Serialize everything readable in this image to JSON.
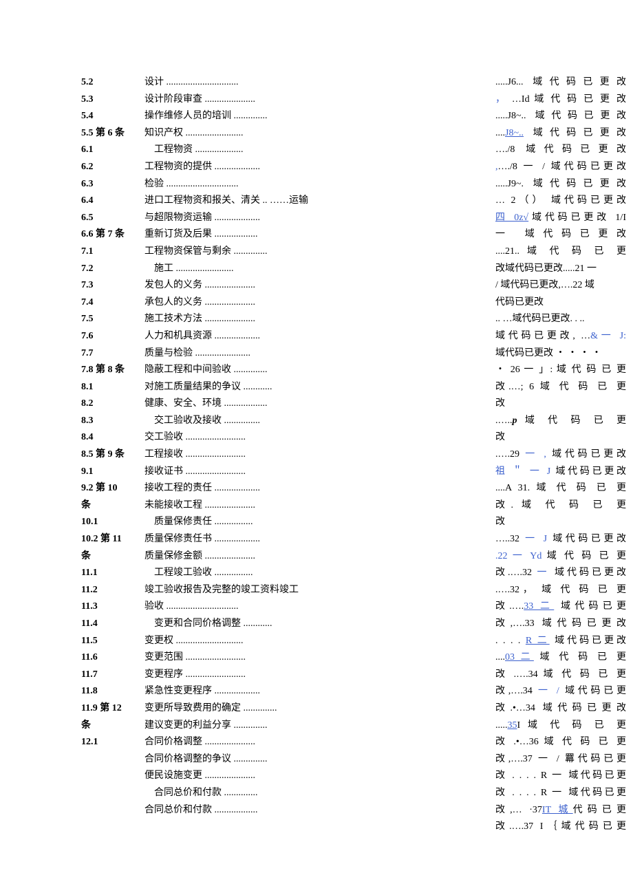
{
  "left_numbers": [
    {
      "t": "5.2"
    },
    {
      "t": "5.3"
    },
    {
      "t": "5.4"
    },
    {
      "t": "5.5 第 6 条"
    },
    {
      "t": "6.1"
    },
    {
      "t": "6.2"
    },
    {
      "t": "6.3"
    },
    {
      "t": "6.4"
    },
    {
      "t": "6.5"
    },
    {
      "t": "6.6 第 7 条"
    },
    {
      "t": "7.1"
    },
    {
      "t": "7.2"
    },
    {
      "t": "7.3"
    },
    {
      "t": "7.4"
    },
    {
      "t": "7.5"
    },
    {
      "t": "7.6"
    },
    {
      "t": "7.7"
    },
    {
      "t": "7.8 第 8 条"
    },
    {
      "t": "8.1"
    },
    {
      "t": "8.2"
    },
    {
      "t": "8.3"
    },
    {
      "t": "8.4"
    },
    {
      "t": "8.5 第 9 条"
    },
    {
      "t": "9.1"
    },
    {
      "t": "9.2 第 10"
    },
    {
      "t": "条"
    },
    {
      "t": "10.1"
    },
    {
      "t": "10.2 第 11"
    },
    {
      "t": "条"
    },
    {
      "t": "11.1"
    },
    {
      "t": "11.2"
    },
    {
      "t": "11.3"
    },
    {
      "t": "11.4"
    },
    {
      "t": "11.5"
    },
    {
      "t": "11.6"
    },
    {
      "t": "11.7"
    },
    {
      "t": "11.8"
    },
    {
      "t": "11.9 第 12"
    },
    {
      "t": "条"
    },
    {
      "t": "12.1"
    }
  ],
  "toc": [
    {
      "txt": "设计 ",
      "lead": ".............................."
    },
    {
      "txt": "设计阶段审查 ",
      "lead": "....................."
    },
    {
      "txt": "操作维修人员的培训 ",
      "lead": ".............."
    },
    {
      "txt": "知识产权 ",
      "lead": "........................"
    },
    {
      "txt": "工程物资 ",
      "lead": "....................",
      "indent": 1
    },
    {
      "txt": "工程物资的提供 ",
      "lead": "..................."
    },
    {
      "txt": "检验 ",
      "lead": ".............................."
    },
    {
      "txt": "进口工程物资和报关、清关 .. ……运输"
    },
    {
      "txt": "与超限物资运输 ",
      "lead": "..................."
    },
    {
      "txt": "重新订货及后果 ",
      "lead": ".................."
    },
    {
      "txt": "工程物资保管与剩余 ",
      "lead": ".............."
    },
    {
      "txt": "施工 ",
      "lead": "........................",
      "indent": 1
    },
    {
      "txt": "发包人的义务 ",
      "lead": "....................."
    },
    {
      "txt": "承包人的义务 ",
      "lead": "....................."
    },
    {
      "txt": "施工技术方法 ",
      "lead": "....................."
    },
    {
      "txt": "人力和机具资源 ",
      "lead": "..................."
    },
    {
      "txt": "质量与检验 ",
      "lead": "......................."
    },
    {
      "txt": "隐蔽工程和中间验收 ",
      "lead": ".............."
    },
    {
      "txt": "对施工质量结果的争议 ",
      "lead": "............"
    },
    {
      "txt": "健康、安全、环境 ",
      "lead": ".................."
    },
    {
      "txt": "交工验收及接收 ",
      "lead": "...............",
      "indent": 1
    },
    {
      "txt": "交工验收 ",
      "lead": "........................."
    },
    {
      "txt": "工程接收 ",
      "lead": "........................."
    },
    {
      "txt": "接收证书 ",
      "lead": "........................."
    },
    {
      "txt": "接收工程的责任 ",
      "lead": "..................."
    },
    {
      "txt": "未能接收工程 ",
      "lead": "....................."
    },
    {
      "txt": "质量保修责任 ",
      "lead": "................",
      "indent": 1
    },
    {
      "txt": "质量保修责任书 ",
      "lead": "..................."
    },
    {
      "txt": "质量保修金额 ",
      "lead": "....................."
    },
    {
      "txt": "工程竣工验收 ",
      "lead": "................",
      "indent": 1
    },
    {
      "txt": "竣工验收报告及完整的竣工资料竣工"
    },
    {
      "txt": "验收 ",
      "lead": ".............................."
    },
    {
      "txt": "变更和合同价格调整 ",
      "lead": "............",
      "indent": 1
    },
    {
      "txt": "变更权 ",
      "lead": "............................"
    },
    {
      "txt": "变更范围 ",
      "lead": "........................."
    },
    {
      "txt": "变更程序 ",
      "lead": "........................."
    },
    {
      "txt": "紧急性变更程序 ",
      "lead": "..................."
    },
    {
      "txt": "变更所导致费用的确定 ",
      "lead": ".............."
    },
    {
      "txt": "建议变更的利益分享 ",
      "lead": ".............."
    },
    {
      "txt": "合同价格调整 ",
      "lead": "....................."
    },
    {
      "txt": "合同价格调整的争议 ",
      "lead": ".............."
    },
    {
      "txt": "便民设施变更 ",
      "lead": "....................."
    },
    {
      "txt": "合同总价和付款 ",
      "lead": "..............",
      "indent": 1
    },
    {
      "txt": "合同总价和付款 ",
      "lead": ".................."
    }
  ],
  "right": [
    {
      "h": ".....J6...   域代码已更改"
    },
    {
      "h": "， …Id 域 代 码 已 更 改",
      "blue_pre": "，"
    },
    {
      "h": ".....J8~..    域代码已更改"
    },
    {
      "h": "....J8~..   域代码已更改",
      "under": "J8~.."
    },
    {
      "h": "…./8         域代码已更改"
    },
    {
      "h": ",…./8 一 / 域代码已更改",
      "blue_pre": ","
    },
    {
      "h": ".....J9~.    域代码已更改"
    },
    {
      "h": "… 2（）   域代码已更改"
    },
    {
      "h": "四 0z√域代码已更改 1/I",
      "under": "四 0z√"
    },
    {
      "h": "一              域代码已更改"
    },
    {
      "h": "....21..       域 代 码 已 更"
    },
    {
      "h": "改域代码已更改.....21 一",
      "noj": true
    },
    {
      "h": "/ 域代码已更改,….22 域",
      "noj": true
    },
    {
      "h": "代码已更改",
      "noj": true
    },
    {
      "h": ".. …域代码已更改. . ..",
      "noj": true
    },
    {
      "h": "域代码已更改, …&一 J:",
      "blue_post": "&一 J:"
    },
    {
      "h": "域代码已更改 ・ ・ ・ ・",
      "noj": true
    },
    {
      "h": "・ 26 一 」: 域 代 码 已 更"
    },
    {
      "h": "改.…;  6   域 代 码 已 更"
    },
    {
      "h": "改",
      "noj": true
    },
    {
      "h": ".…..p         域 代 码 已 更",
      "bold_p": true
    },
    {
      "h": "改",
      "noj": true
    },
    {
      "h": ".….29 一 , 域代码已更改",
      "blue_part": "一 ,"
    },
    {
      "h": "祖 ＂ 一 J 域代码已更改",
      "blue_pre": "祖 ＂ 一 J"
    },
    {
      "h": "....A 31.       域 代 码 已 更"
    },
    {
      "h": "改.            域 代 码 已 更"
    },
    {
      "h": "改",
      "noj": true
    },
    {
      "h": "…..32 一 J 域代码已更改",
      "blue_part": "一 J"
    },
    {
      "h": " .22 一 Yd 域 代 码 已 更",
      "blue_pre": ".22 一 Yd"
    },
    {
      "h": "改.….32 一 域代码已更改",
      "blue_part": "一"
    },
    {
      "h": ".….32，  域 代 码 已 更"
    },
    {
      "h": "改.….33 二 域代码已更",
      "under": "33 二"
    },
    {
      "h": "改,….33 域代码已更改"
    },
    {
      "h": ". . . . R 二 域代码已更改",
      "under": "R 二"
    },
    {
      "h": "....03 二 域 代 码 已 更",
      "under": "03 二"
    },
    {
      "h": "改 .….34 域 代 码 已 更"
    },
    {
      "h": "改,….34 一 / 域代码已更",
      "blue_part": "一 /"
    },
    {
      "h": "改.•…34 域代码已更改"
    },
    {
      "h": ".....35I 域 代 码 已 更",
      "under": "35"
    },
    {
      "h": "改   .•…36 域 代 码 已 更"
    },
    {
      "h": "改,….37 一 / 羃代码已更"
    },
    {
      "h": "改 . . . . R 一 域代码已更"
    },
    {
      "h": "改 . . . . R 一 域代码已更"
    },
    {
      "h": "改,… ·37IT 城代码已更",
      "under": "IT 城"
    },
    {
      "h": "改.….37 I｛域代码已更"
    }
  ]
}
